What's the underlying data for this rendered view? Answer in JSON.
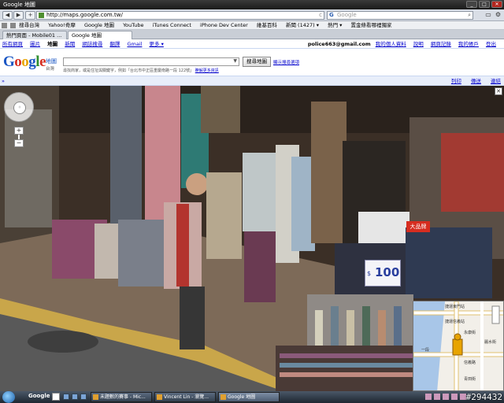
{
  "window": {
    "title": "Google 地圖"
  },
  "browser": {
    "url": "http://maps.google.com.tw/",
    "search_placeholder": "Google",
    "back": "◀",
    "forward": "▶",
    "reload": "+",
    "bookmarks": [
      "搜尋台灣",
      "Yahoo!奇摩",
      "Google 地圖",
      "YouTube",
      "iTunes Connect",
      "iPhone Dev Center",
      "維基百科",
      "新聞 (1427) ▾",
      "熱門 ▾",
      "置金條看哪裡獨家"
    ],
    "tabs": [
      {
        "label": "熱門頁面 - Mobile01 ..."
      },
      {
        "label": "Google 地圖"
      }
    ]
  },
  "google_nav": {
    "links": [
      "所有網頁",
      "圖片",
      "地圖",
      "新聞",
      "網誌搜尋",
      "翻譯",
      "Gmail",
      "更多 ▾"
    ],
    "current": "地圖",
    "user_email": "police663@gmail.com",
    "right_links": [
      "我的個人資料",
      "說明",
      "網頁記錄",
      "我的帳戶",
      "登出"
    ]
  },
  "maps_header": {
    "logo_parts": [
      "G",
      "o",
      "o",
      "g",
      "l",
      "e"
    ],
    "product": "地圖",
    "region": "台灣",
    "search_value": "",
    "search_button": "搜尋地圖",
    "show_options": "顯示搜尋選項",
    "hint": "尋找商家，或是住址與關鍵字，例如「台北市中正區重慶南路一段 122號」",
    "hint_link": "瞭解更多資訊"
  },
  "map_toolbar": {
    "collapse": "»",
    "links": [
      "列印",
      "傳送",
      "連結"
    ]
  },
  "street_view": {
    "price_sign": "100",
    "price_symbol": "$",
    "red_sign": "大品牌",
    "close": "✕",
    "zoom_in": "+",
    "zoom_out": "−",
    "compass_center": "◦"
  },
  "minimap": {
    "labels": [
      "捷運東門站",
      "捷運信義站",
      "一段",
      "永康街",
      "信義路",
      "麗水街",
      "青田街"
    ]
  },
  "taskbar": {
    "search_brand": "Google",
    "tasks": [
      {
        "label": "未題數的賽事 - Mic..."
      },
      {
        "label": "Vincent Lin - 瀏覽..."
      },
      {
        "label": "Google 地圖"
      }
    ],
    "watermark": "#294432"
  },
  "colors": {
    "link": "#0000cc",
    "accent_blue": "#1a56c4",
    "google_red": "#d62d20",
    "taskbar": "#1e2630"
  }
}
